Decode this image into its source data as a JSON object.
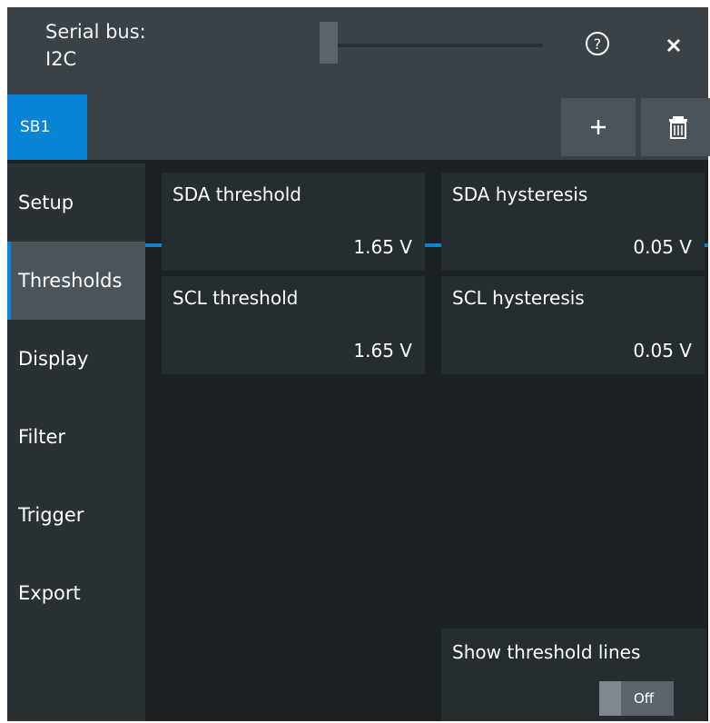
{
  "header": {
    "title_line1": "Serial bus:",
    "title_line2": "I2C",
    "help_icon": "help-circle-icon",
    "close_icon": "close-icon"
  },
  "tabs": {
    "active": "SB1",
    "add_icon": "plus-icon",
    "delete_icon": "trash-icon"
  },
  "sidebar": {
    "items": [
      {
        "label": "Setup"
      },
      {
        "label": "Thresholds"
      },
      {
        "label": "Display"
      },
      {
        "label": "Filter"
      },
      {
        "label": "Trigger"
      },
      {
        "label": "Export"
      }
    ],
    "selected": "Thresholds"
  },
  "thresholds": {
    "sda_threshold": {
      "label": "SDA threshold",
      "value": "1.65 V"
    },
    "sda_hysteresis": {
      "label": "SDA hysteresis",
      "value": "0.05 V"
    },
    "scl_threshold": {
      "label": "SCL threshold",
      "value": "1.65 V"
    },
    "scl_hysteresis": {
      "label": "SCL hysteresis",
      "value": "0.05 V"
    }
  },
  "show_threshold_lines": {
    "label": "Show threshold lines",
    "state": "Off"
  },
  "colors": {
    "accent": "#0a84d6",
    "background": "#1b2124",
    "panel": "#262d31",
    "header": "#3a4247"
  }
}
